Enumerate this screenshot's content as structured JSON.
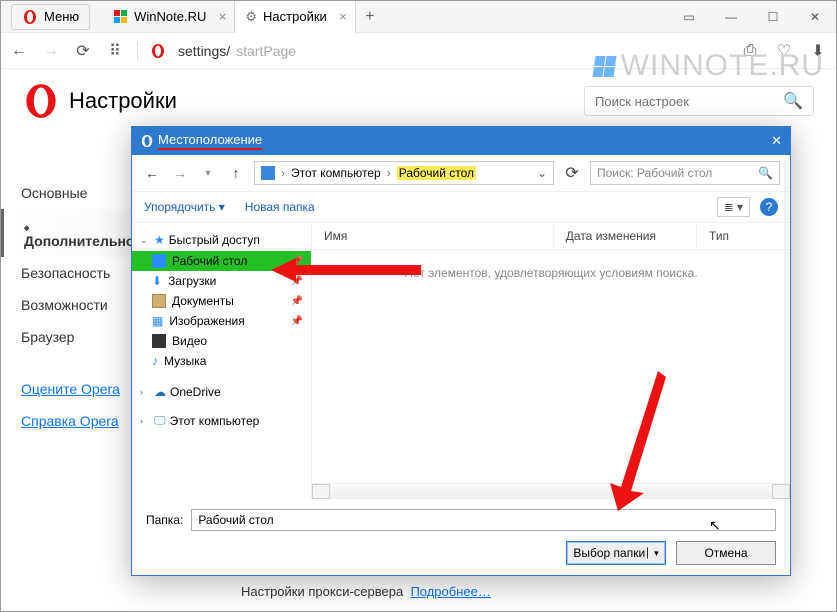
{
  "titlebar": {
    "menu": "Меню",
    "tab1": "WinNote.RU",
    "tab2": "Настройки",
    "newtab": "+"
  },
  "toolbar": {
    "url_path": "settings/",
    "url_page": "startPage"
  },
  "page": {
    "title": "Настройки",
    "search_placeholder": "Поиск настроек"
  },
  "sidebar": {
    "items": [
      "Основные",
      "Дополнительно",
      "Безопасность",
      "Возможности",
      "Браузер"
    ],
    "links": [
      "Оцените Opera",
      "Справка Opera"
    ]
  },
  "proxy": {
    "label": "Настройки прокси-сервера",
    "more": "Подробнее…"
  },
  "watermark": "WINNOTE.RU",
  "dialog": {
    "title": "Местоположение",
    "crumb1": "Этот компьютер",
    "crumb2": "Рабочий стол",
    "search_placeholder": "Поиск: Рабочий стол",
    "tools": {
      "organize": "Упорядочить",
      "newfolder": "Новая папка"
    },
    "columns": {
      "name": "Имя",
      "modified": "Дата изменения",
      "type": "Тип"
    },
    "empty": "Нет элементов, удовлетворяющих условиям поиска.",
    "tree": {
      "quick": "Быстрый доступ",
      "items": [
        "Рабочий стол",
        "Загрузки",
        "Документы",
        "Изображения",
        "Видео",
        "Музыка"
      ],
      "onedrive": "OneDrive",
      "thispc": "Этот компьютер"
    },
    "folder_label": "Папка:",
    "folder_value": "Рабочий стол",
    "ok": "Выбор папки",
    "cancel": "Отмена"
  }
}
